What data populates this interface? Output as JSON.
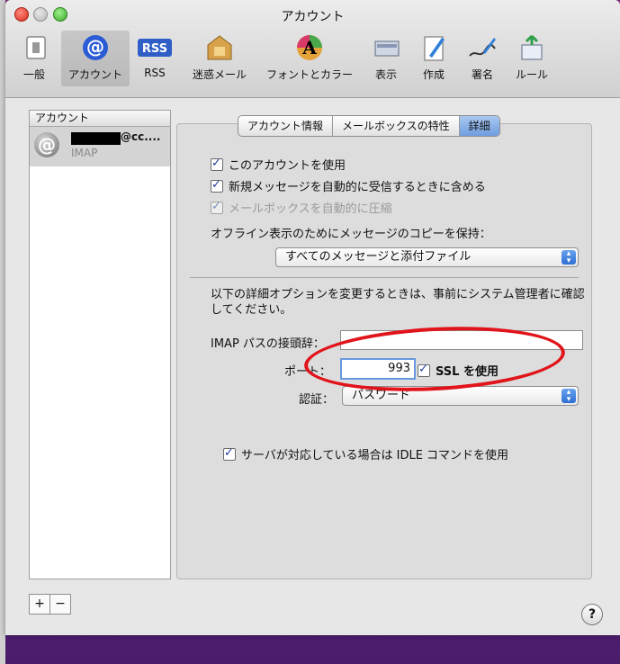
{
  "window": {
    "title": "アカウント"
  },
  "toolbar": {
    "items": [
      {
        "label": "一般",
        "icon": "general-icon"
      },
      {
        "label": "アカウント",
        "icon": "at-icon"
      },
      {
        "label": "RSS",
        "icon": "rss-icon"
      },
      {
        "label": "迷惑メール",
        "icon": "junk-icon"
      },
      {
        "label": "フォントとカラー",
        "icon": "fonts-colors-icon"
      },
      {
        "label": "表示",
        "icon": "view-icon"
      },
      {
        "label": "作成",
        "icon": "compose-icon"
      },
      {
        "label": "署名",
        "icon": "signature-icon"
      },
      {
        "label": "ルール",
        "icon": "rules-icon"
      }
    ]
  },
  "accounts": {
    "header": "アカウント",
    "items": [
      {
        "email_suffix": "@cc....",
        "type": "IMAP"
      }
    ]
  },
  "tabs": {
    "info": "アカウント情報",
    "mailbox": "メールボックスの特性",
    "advanced": "詳細"
  },
  "options": {
    "use_account": "このアカウントを使用",
    "auto_fetch": "新規メッセージを自動的に受信するときに含める",
    "compact": "メールボックスを自動的に圧縮",
    "offline_label": "オフライン表示のためにメッセージのコピーを保持：",
    "offline_value": "すべてのメッセージと添付ファイル",
    "notice": "以下の詳細オプションを変更するときは、事前にシステム管理者に確認してください。",
    "imap_prefix_label": "IMAP パスの接頭辞：",
    "imap_prefix_value": "",
    "port_label": "ポート：",
    "port_value": "993",
    "ssl_label": "SSL を使用",
    "auth_label": "認証：",
    "auth_value": "パスワード",
    "idle_label": "サーバが対応している場合は IDLE コマンドを使用"
  },
  "buttons": {
    "add": "+",
    "remove": "−",
    "help": "?"
  },
  "colors": {
    "highlight_ellipse": "#e0141a",
    "selected_tab": "#7aa7e6"
  }
}
